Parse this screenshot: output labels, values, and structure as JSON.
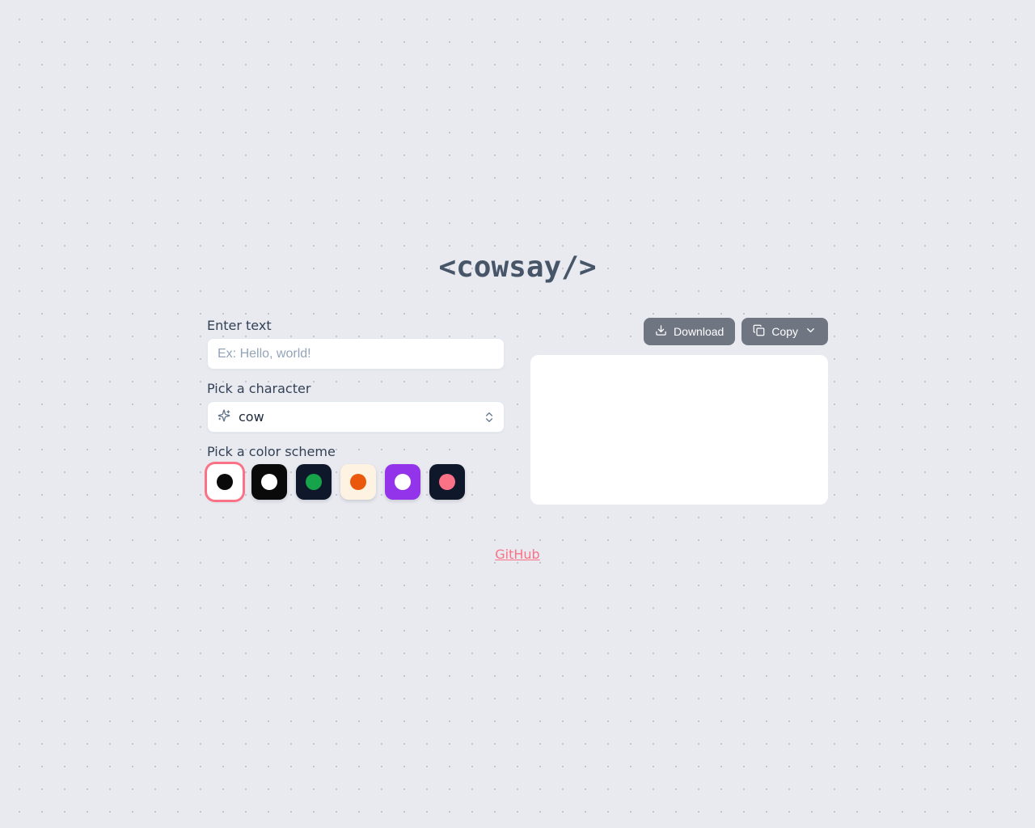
{
  "title": "<cowsay/>",
  "labels": {
    "enter_text": "Enter text",
    "pick_character": "Pick a character",
    "pick_color": "Pick a color scheme"
  },
  "text_input": {
    "placeholder": "Ex: Hello, world!",
    "value": ""
  },
  "character_select": {
    "value": "cow"
  },
  "color_schemes": [
    {
      "bg": "#ffffff",
      "dot": "#0a0a0a",
      "selected": true
    },
    {
      "bg": "#0a0a0a",
      "dot": "#ffffff",
      "selected": false
    },
    {
      "bg": "#0f172a",
      "dot": "#16a34a",
      "selected": false
    },
    {
      "bg": "#fef3e2",
      "dot": "#ea580c",
      "selected": false
    },
    {
      "bg": "#9333ea",
      "dot": "#ffffff",
      "selected": false
    },
    {
      "bg": "#0f172a",
      "dot": "#fb7185",
      "selected": false
    }
  ],
  "toolbar": {
    "download_label": "Download",
    "copy_label": "Copy"
  },
  "footer": {
    "github": "GitHub"
  }
}
